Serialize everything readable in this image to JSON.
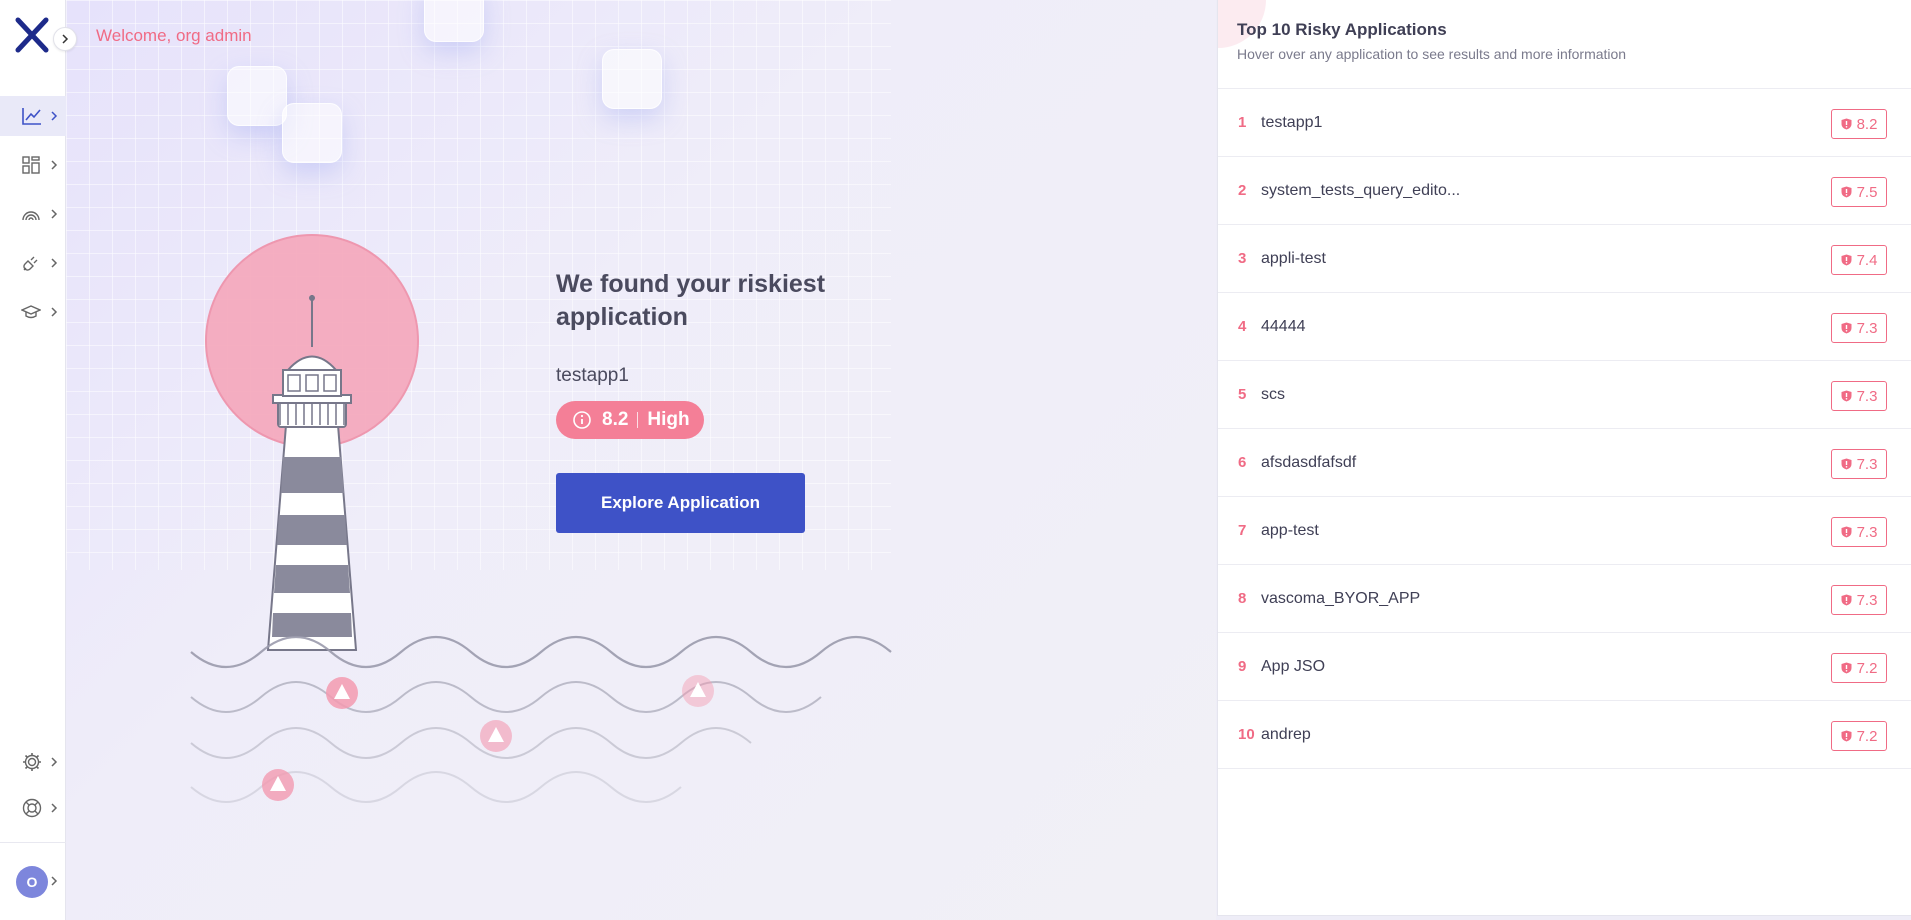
{
  "header": {
    "welcome": "Welcome, org admin"
  },
  "sidebar": {
    "items": [
      {
        "icon": "chart-line-icon",
        "active": true
      },
      {
        "icon": "dashboard-grid-icon",
        "active": false
      },
      {
        "icon": "radar-icon",
        "active": false
      },
      {
        "icon": "plug-icon",
        "active": false
      },
      {
        "icon": "graduation-cap-icon",
        "active": false
      }
    ],
    "bottom_items": [
      {
        "icon": "gear-icon"
      },
      {
        "icon": "lifebuoy-icon"
      }
    ],
    "avatar_initial": "O"
  },
  "hero": {
    "headline": "We found your riskiest application",
    "app_name": "testapp1",
    "score": "8.2",
    "severity": "High",
    "explore_label": "Explore Application"
  },
  "risky_panel": {
    "title": "Top 10 Risky Applications",
    "subtitle": "Hover over any application to see results and more information",
    "apps": [
      {
        "rank": "1",
        "name": "testapp1",
        "score": "8.2"
      },
      {
        "rank": "2",
        "name": "system_tests_query_edito...",
        "score": "7.5"
      },
      {
        "rank": "3",
        "name": "appli-test",
        "score": "7.4"
      },
      {
        "rank": "4",
        "name": "44444",
        "score": "7.3"
      },
      {
        "rank": "5",
        "name": "scs",
        "score": "7.3"
      },
      {
        "rank": "6",
        "name": "afsdasdfafsdf",
        "score": "7.3"
      },
      {
        "rank": "7",
        "name": "app-test",
        "score": "7.3"
      },
      {
        "rank": "8",
        "name": "vascoma_BYOR_APP",
        "score": "7.3"
      },
      {
        "rank": "9",
        "name": "App JSO",
        "score": "7.2"
      },
      {
        "rank": "10",
        "name": "andrep",
        "score": "7.2"
      }
    ]
  },
  "colors": {
    "accent": "#3e52c7",
    "risk": "#f06b85",
    "risk_fill": "#f47f97"
  }
}
